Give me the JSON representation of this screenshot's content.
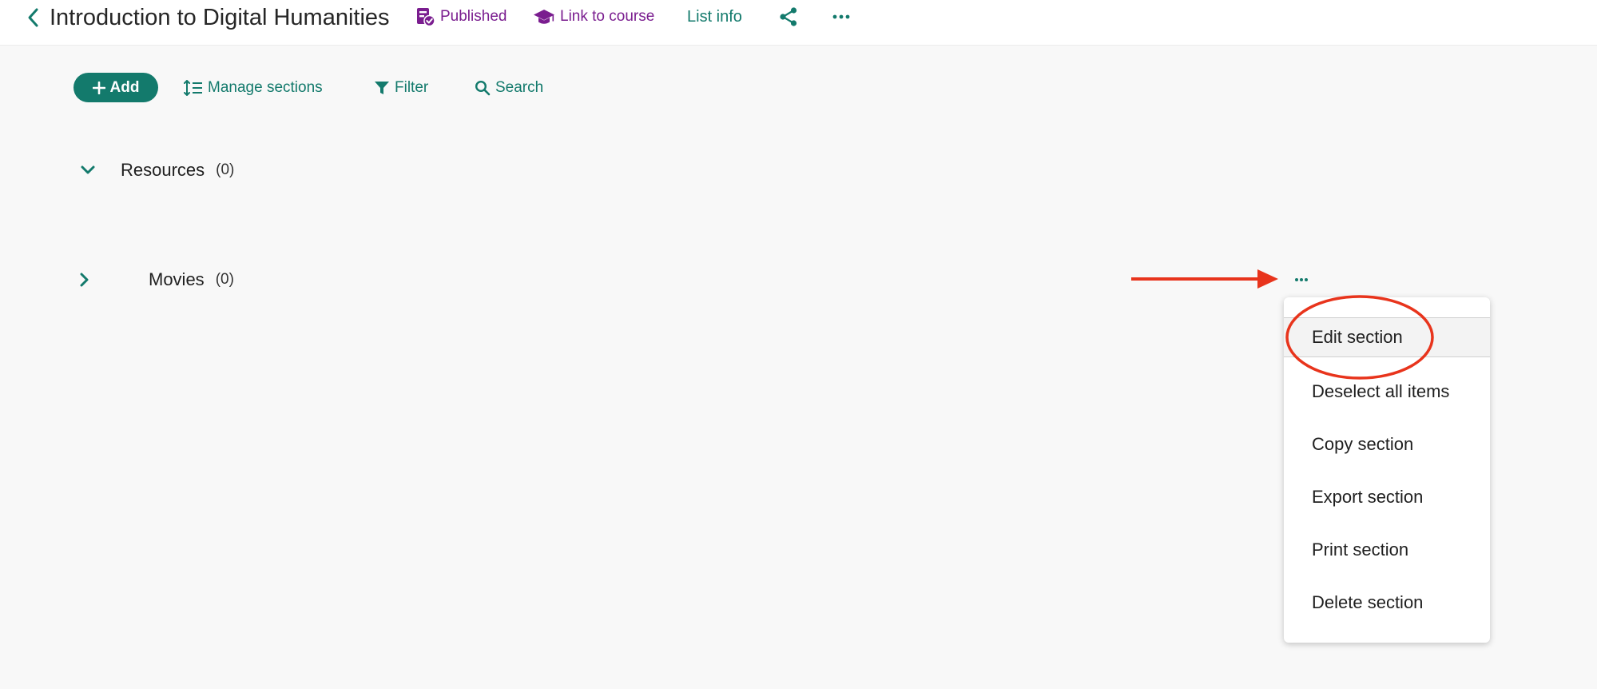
{
  "header": {
    "title": "Introduction to Digital Humanities",
    "status_badge": "Published",
    "link_course": "Link to course",
    "list_info": "List info",
    "icons": {
      "back": "chevron-left-icon",
      "published": "document-check-icon",
      "course": "graduation-cap-icon",
      "share": "share-icon",
      "more": "ellipsis-icon"
    }
  },
  "toolbar": {
    "add": "Add",
    "manage_sections": "Manage sections",
    "filter": "Filter",
    "search": "Search"
  },
  "sections": [
    {
      "name": "Resources",
      "count": "(0)",
      "expanded": true
    },
    {
      "name": "Movies",
      "count": "(0)",
      "expanded": false
    }
  ],
  "section_menu": {
    "items": [
      {
        "label": "Edit section",
        "highlighted": true
      },
      {
        "label": "Deselect all items"
      },
      {
        "label": "Copy section"
      },
      {
        "label": "Export section"
      },
      {
        "label": "Print section"
      },
      {
        "label": "Delete section"
      }
    ]
  },
  "colors": {
    "accent": "#137a6c",
    "brand_purple": "#7a1d8f",
    "annotation": "#e8341c",
    "background": "#f8f8f8"
  }
}
